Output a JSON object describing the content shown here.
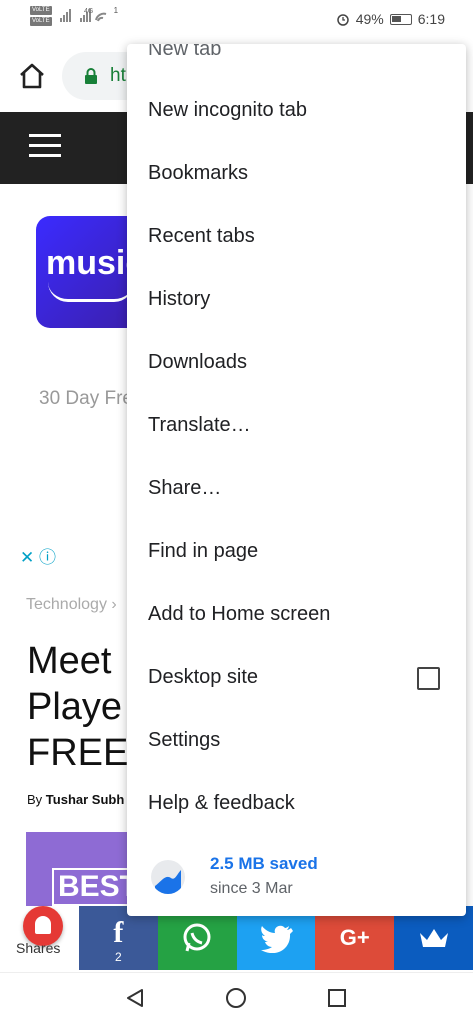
{
  "status_bar": {
    "sim1": "VoLTE",
    "sim2": "VoLTE",
    "network": "4G",
    "hotspot_count": "1",
    "battery": "49%",
    "time": "6:19"
  },
  "toolbar": {
    "url_partial": "ht"
  },
  "page": {
    "music_logo_text": "music",
    "trial_text": "30 Day Fre",
    "category": "Technology",
    "headline_lines": [
      "Meet",
      "Playe",
      "FREE"
    ],
    "byline_prefix": "By",
    "author": "Tushar Subh",
    "best_text": "BEST"
  },
  "menu": {
    "items": [
      {
        "label": "New tab"
      },
      {
        "label": "New incognito tab"
      },
      {
        "label": "Bookmarks"
      },
      {
        "label": "Recent tabs"
      },
      {
        "label": "History"
      },
      {
        "label": "Downloads"
      },
      {
        "label": "Translate…"
      },
      {
        "label": "Share…"
      },
      {
        "label": "Find in page"
      },
      {
        "label": "Add to Home screen"
      },
      {
        "label": "Desktop site"
      },
      {
        "label": "Settings"
      },
      {
        "label": "Help & feedback"
      }
    ],
    "data_saver": {
      "title": "2.5 MB saved",
      "subtitle": "since 3 Mar"
    }
  },
  "share_bar": {
    "shares_label": "Shares",
    "facebook_count": "2",
    "facebook_glyph": "f",
    "googleplus_glyph": "G+"
  },
  "colors": {
    "url_green": "#188038",
    "saver_blue": "#1a73e8",
    "facebook": "#3b5998",
    "whatsapp": "#25a244",
    "twitter": "#1da1f2",
    "googleplus": "#dd4b39"
  }
}
